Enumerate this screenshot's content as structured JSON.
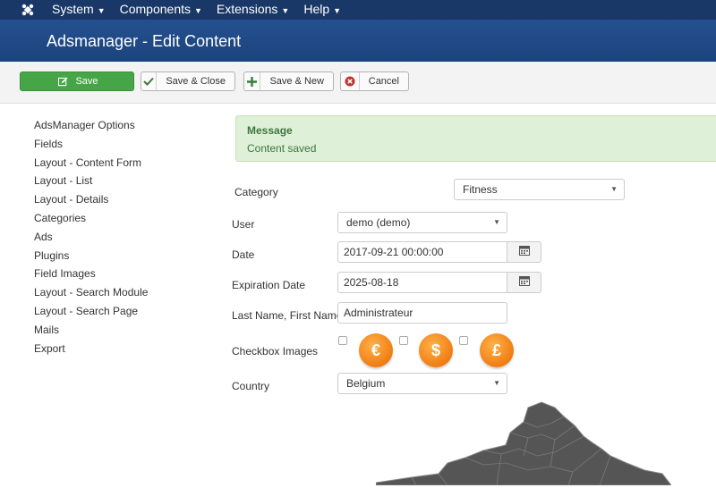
{
  "topbar": {
    "menu": [
      {
        "label": "System"
      },
      {
        "label": "Components"
      },
      {
        "label": "Extensions"
      },
      {
        "label": "Help"
      }
    ]
  },
  "header": {
    "title": "Adsmanager - Edit Content"
  },
  "toolbar": {
    "save_label": "Save",
    "save_close_label": "Save & Close",
    "save_new_label": "Save & New",
    "cancel_label": "Cancel"
  },
  "sidebar": {
    "items": [
      {
        "label": "AdsManager Options"
      },
      {
        "label": "Fields"
      },
      {
        "label": "Layout - Content Form"
      },
      {
        "label": "Layout - List"
      },
      {
        "label": "Layout - Details"
      },
      {
        "label": "Categories"
      },
      {
        "label": "Ads"
      },
      {
        "label": "Plugins"
      },
      {
        "label": "Field Images"
      },
      {
        "label": "Layout - Search Module"
      },
      {
        "label": "Layout - Search Page"
      },
      {
        "label": "Mails"
      },
      {
        "label": "Export"
      }
    ]
  },
  "message": {
    "title": "Message",
    "text": "Content saved"
  },
  "form": {
    "category": {
      "label": "Category",
      "value": "Fitness"
    },
    "user": {
      "label": "User",
      "value": "demo (demo)"
    },
    "date": {
      "label": "Date",
      "value": "2017-09-21 00:00:00"
    },
    "expiration": {
      "label": "Expiration Date",
      "value": "2025-08-18"
    },
    "name": {
      "label": "Last Name, First Name",
      "value": "Administrateur"
    },
    "checkbox_images": {
      "label": "Checkbox Images",
      "options": [
        {
          "symbol": "€",
          "checked": false
        },
        {
          "symbol": "$",
          "checked": false
        },
        {
          "symbol": "£",
          "checked": false
        }
      ]
    },
    "country": {
      "label": "Country",
      "value": "Belgium"
    }
  },
  "colors": {
    "topbar": "#1a3867",
    "titlebar": "#1f4b8a",
    "save_button": "#46a546",
    "message_bg": "#dff0d8",
    "coin": "#f07d12",
    "map": "#555555"
  }
}
